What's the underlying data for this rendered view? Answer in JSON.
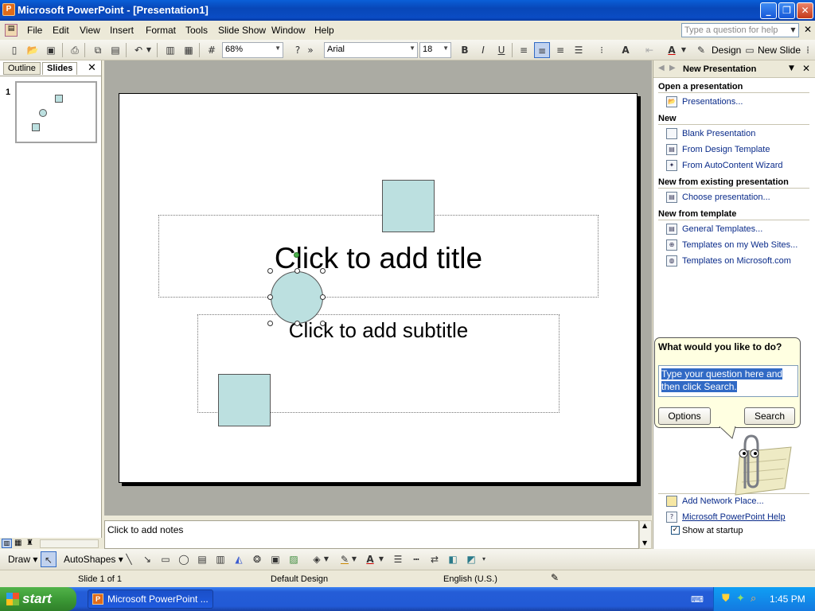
{
  "window": {
    "title": "Microsoft PowerPoint - [Presentation1]",
    "app_icon": "P"
  },
  "menu": {
    "items": [
      "File",
      "Edit",
      "View",
      "Insert",
      "Format",
      "Tools",
      "Slide Show",
      "Window",
      "Help"
    ],
    "ask_placeholder": "Type a question for help"
  },
  "toolbar": {
    "zoom": "68%",
    "font": "Arial",
    "size": "18",
    "design_label": "Design",
    "new_slide_label": "New Slide"
  },
  "left_pane": {
    "tabs": [
      "Outline",
      "Slides"
    ],
    "slide_number": "1"
  },
  "slide": {
    "title_placeholder": "Click to add title",
    "subtitle_placeholder": "Click to add subtitle"
  },
  "notes": {
    "placeholder": "Click to add notes"
  },
  "task_pane": {
    "title": "New Presentation",
    "sections": [
      {
        "header": "Open a presentation",
        "links": [
          "Presentations..."
        ]
      },
      {
        "header": "New",
        "links": [
          "Blank Presentation",
          "From Design Template",
          "From AutoContent Wizard"
        ]
      },
      {
        "header": "New from existing presentation",
        "links": [
          "Choose presentation..."
        ]
      },
      {
        "header": "New from template",
        "links": [
          "General Templates...",
          "Templates on my Web Sites...",
          "Templates on Microsoft.com"
        ]
      }
    ],
    "bottom_links": [
      "Add Network Place...",
      "Microsoft PowerPoint Help"
    ],
    "show_at_startup": "Show at startup"
  },
  "assistant": {
    "question": "What would you like to do?",
    "input_text": "Type your question here and then click Search.",
    "options_label": "Options",
    "search_label": "Search"
  },
  "drawing": {
    "draw_label": "Draw",
    "autoshapes_label": "AutoShapes"
  },
  "status": {
    "slide_info": "Slide 1 of 1",
    "design": "Default Design",
    "language": "English (U.S.)"
  },
  "taskbar": {
    "start_label": "start",
    "app_button": "Microsoft PowerPoint ...",
    "clock": "1:45 PM"
  },
  "colors": {
    "shape_fill": "#bce0e0",
    "titlebar": "#0a4cc4",
    "start_green": "#3c9a36"
  }
}
